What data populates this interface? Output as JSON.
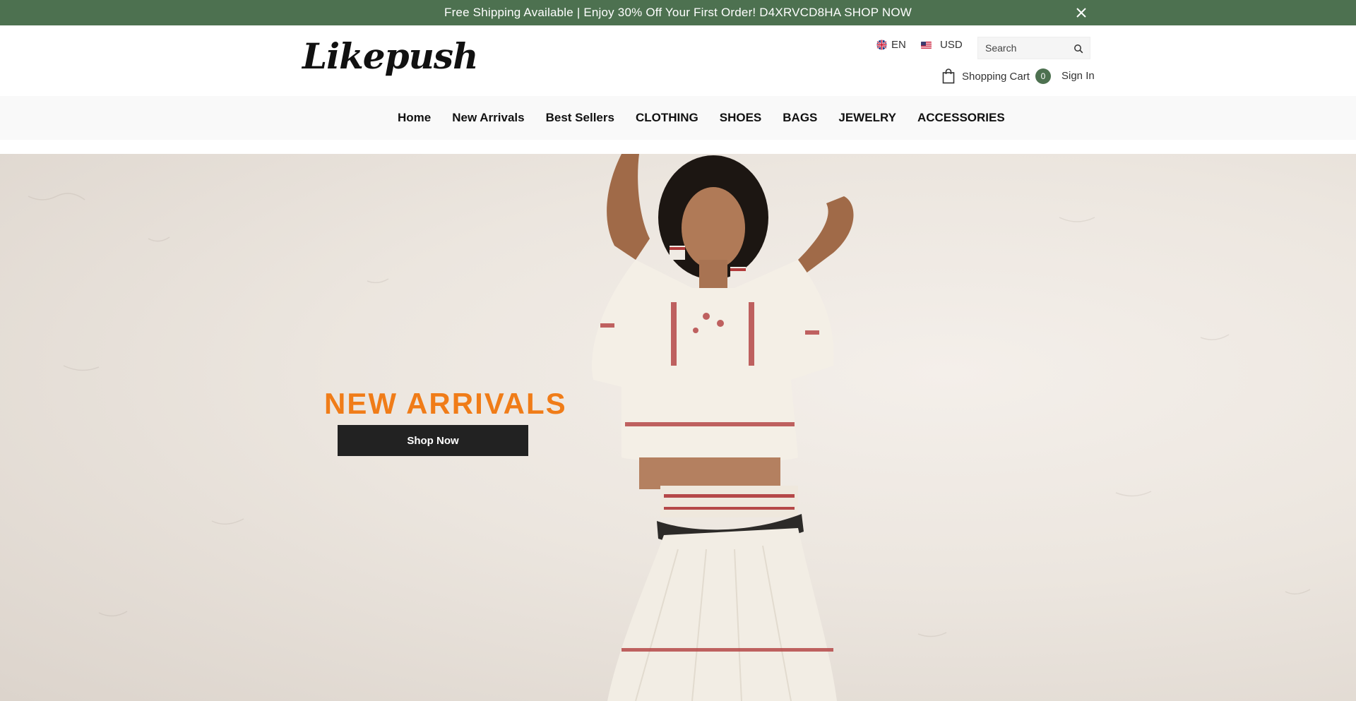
{
  "announcement": {
    "text": "Free Shipping Available | Enjoy 30% Off Your First Order! D4XRVCD8HA SHOP NOW",
    "close_icon": "close-icon",
    "bg_color": "#4d7150"
  },
  "header": {
    "logo_text": "Likepush",
    "language": "EN",
    "currency": "USD",
    "search": {
      "placeholder": "Search"
    },
    "cart": {
      "label": "Shopping Cart",
      "count": "0"
    },
    "sign_in": "Sign In"
  },
  "nav": {
    "items": [
      "Home",
      "New Arrivals",
      "Best Sellers",
      "CLOTHING",
      "SHOES",
      "BAGS",
      "JEWELRY",
      "ACCESSORIES"
    ]
  },
  "hero": {
    "title": "NEW ARRIVALS",
    "button": "Shop Now",
    "title_color": "#f07c18"
  }
}
